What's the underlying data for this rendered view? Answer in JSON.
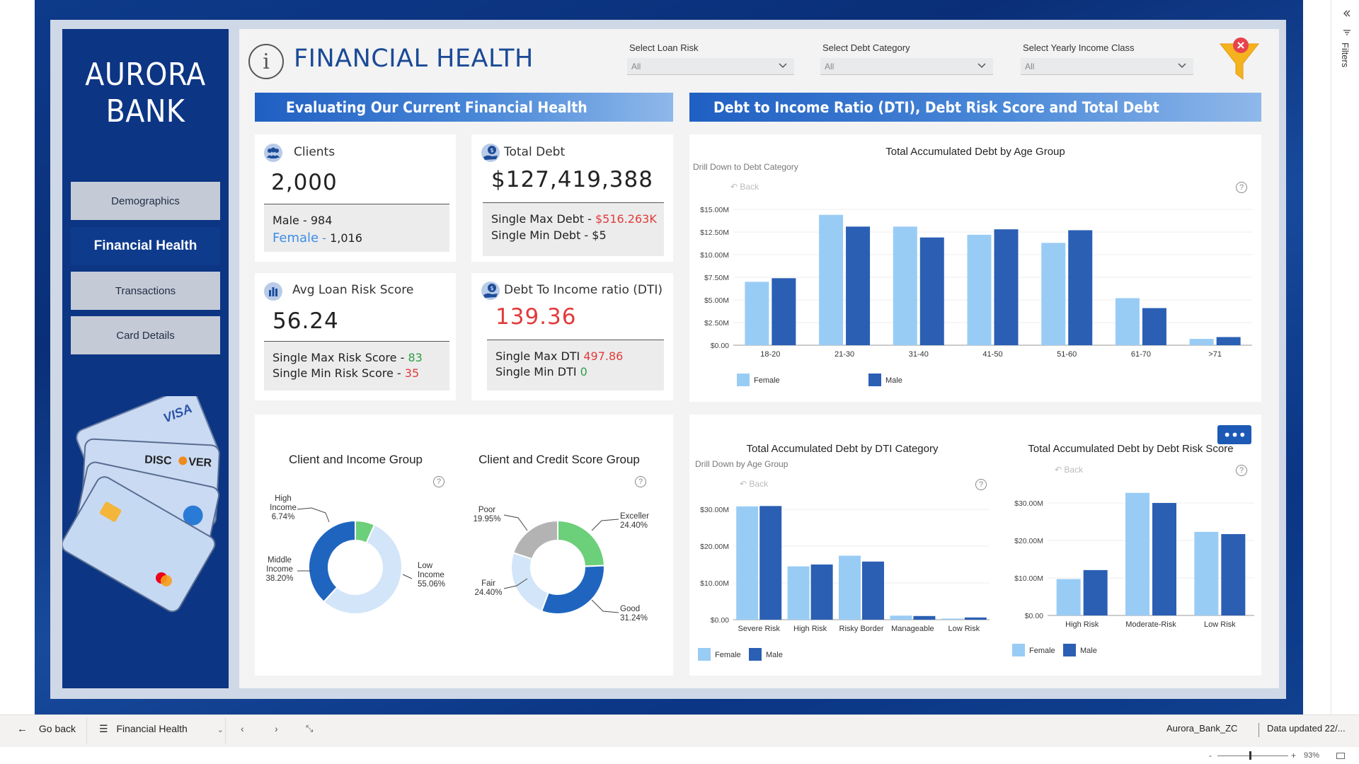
{
  "brand": {
    "line1": "AURORA",
    "line2": "BANK"
  },
  "nav": [
    {
      "label": "Demographics",
      "active": false
    },
    {
      "label": "Financial Health",
      "active": true
    },
    {
      "label": "Transactions",
      "active": false
    },
    {
      "label": "Card Details",
      "active": false
    }
  ],
  "header": {
    "title_icon": "i",
    "title": "FINANCIAL HEALTH"
  },
  "slicers": [
    {
      "label": "Select Loan Risk",
      "value": "All"
    },
    {
      "label": "Select Debt Category",
      "value": "All"
    },
    {
      "label": "Select Yearly Income Class",
      "value": "All"
    }
  ],
  "icons": {
    "funnel": "clear-filter-icon",
    "help": "?",
    "back_arrow": "↶",
    "more": "•••"
  },
  "sections": {
    "left": "Evaluating Our  Current Financial Health",
    "right": "Debt to Income Ratio (DTI), Debt Risk Score and Total Debt"
  },
  "kpis": {
    "clients": {
      "label": "Clients",
      "value": "2,000",
      "male_label": "Male",
      "male_value": "984",
      "female_label": "Female",
      "female_value": "1,016",
      "sep": "-"
    },
    "total_debt": {
      "label": "Total Debt",
      "value": "$127,419,388",
      "max_label": "Single Max Debt -",
      "max_value": "$516.263K",
      "min_label": "Single Min Debt -",
      "min_value": "$5"
    },
    "loan_risk": {
      "label": "Avg Loan Risk Score",
      "value": "56.24",
      "max_label": "Single Max Risk Score -",
      "max_value": "83",
      "min_label": "Single Min Risk Score -",
      "min_value": "35"
    },
    "dti": {
      "label": "Debt To Income ratio (DTI)",
      "value": "139.36",
      "max_label": "Single Max DTI",
      "max_value": "497.86",
      "min_label": "Single Min DTI",
      "min_value": "0"
    }
  },
  "colors": {
    "female": "#99ccf5",
    "male": "#2b5fb4",
    "red": "#e23b3b",
    "green": "#2e9e44",
    "female_text": "#3d8ee6",
    "header_blue": "#1b4a96"
  },
  "age_chart": {
    "title": "Total Accumulated Debt by Age Group",
    "drill": "Drill Down to Debt Category",
    "back": "Back",
    "y_ticks": [
      "$0.00",
      "$2.50M",
      "$5.00M",
      "$7.50M",
      "$10.00M",
      "$12.50M",
      "$15.00M"
    ],
    "legend": [
      "Female",
      "Male"
    ]
  },
  "dti_chart": {
    "title": "Total Accumulated Debt by DTI Category",
    "drill": "Drill Down by Age Group",
    "back": "Back",
    "y_ticks": [
      "$0.00",
      "$10.00M",
      "$20.00M",
      "$30.00M"
    ],
    "legend": [
      "Female",
      "Male"
    ]
  },
  "risk_chart": {
    "title": "Total Accumulated Debt by Debt Risk Score",
    "back": "Back",
    "y_ticks": [
      "$0.00",
      "$10.00M",
      "$20.00M",
      "$30.00M"
    ],
    "legend": [
      "Female",
      "Male"
    ]
  },
  "income_donut": {
    "title": "Client and Income Group",
    "labels": [
      {
        "l1": "High",
        "l2": "Income",
        "l3": "6.74%"
      },
      {
        "l1": "Middle",
        "l2": "Income",
        "l3": "38.20%"
      },
      {
        "l1": "Low",
        "l2": "Income",
        "l3": "55.06%"
      }
    ]
  },
  "credit_donut": {
    "title": "Client and Credit Score Group",
    "labels": [
      {
        "l1": "Poor",
        "l2": "19.95%"
      },
      {
        "l1": "Exceller",
        "l2": "24.40%"
      },
      {
        "l1": "Fair",
        "l2": "24.40%"
      },
      {
        "l1": "Good",
        "l2": "31.24%"
      }
    ]
  },
  "filters_pane": {
    "label": "Filters"
  },
  "bottom_bar": {
    "go_back": "Go back",
    "page": "Financial Health",
    "file": "Aurora_Bank_ZC",
    "updated": "Data updated 22/...",
    "zoom": "93%"
  },
  "chart_data": [
    {
      "type": "bar",
      "title": "Total Accumulated Debt by Age Group",
      "categories": [
        "18-20",
        "21-30",
        "31-40",
        "41-50",
        "51-60",
        "61-70",
        ">71"
      ],
      "series": [
        {
          "name": "Female",
          "values": [
            7.0,
            14.4,
            13.1,
            12.2,
            11.3,
            5.2,
            0.7
          ]
        },
        {
          "name": "Male",
          "values": [
            7.4,
            13.1,
            11.9,
            12.8,
            12.7,
            4.1,
            0.9
          ]
        }
      ],
      "ylim": [
        0,
        15
      ],
      "unit": "M"
    },
    {
      "type": "bar",
      "title": "Total Accumulated Debt by DTI Category",
      "categories": [
        "Severe Risk",
        "High Risk",
        "Risky Border",
        "Manageable",
        "Low Risk"
      ],
      "series": [
        {
          "name": "Female",
          "values": [
            30.8,
            14.5,
            17.4,
            1.1,
            0.3
          ]
        },
        {
          "name": "Male",
          "values": [
            30.9,
            15.0,
            15.8,
            1.0,
            0.6
          ]
        }
      ],
      "ylim": [
        0,
        30
      ],
      "unit": "M"
    },
    {
      "type": "bar",
      "title": "Total Accumulated Debt by Debt Risk Score",
      "categories": [
        "High Risk",
        "Moderate-Risk",
        "Low Risk"
      ],
      "series": [
        {
          "name": "Female",
          "values": [
            9.7,
            32.7,
            22.3
          ]
        },
        {
          "name": "Male",
          "values": [
            12.1,
            30.0,
            21.7
          ]
        }
      ],
      "ylim": [
        0,
        30
      ],
      "unit": "M"
    },
    {
      "type": "pie",
      "title": "Client and Income Group",
      "slices": [
        {
          "name": "High Income",
          "value": 6.74,
          "color": "#6ccf7a"
        },
        {
          "name": "Low Income",
          "value": 55.06,
          "color": "#d3e5f8"
        },
        {
          "name": "Middle Income",
          "value": 38.2,
          "color": "#1f65c0"
        }
      ]
    },
    {
      "type": "pie",
      "title": "Client and Credit Score Group",
      "slices": [
        {
          "name": "Excellent",
          "value": 24.4,
          "color": "#6ccf7a"
        },
        {
          "name": "Good",
          "value": 31.24,
          "color": "#1f65c0"
        },
        {
          "name": "Fair",
          "value": 24.4,
          "color": "#d3e5f8"
        },
        {
          "name": "Poor",
          "value": 19.95,
          "color": "#b3b3b3"
        }
      ]
    }
  ]
}
